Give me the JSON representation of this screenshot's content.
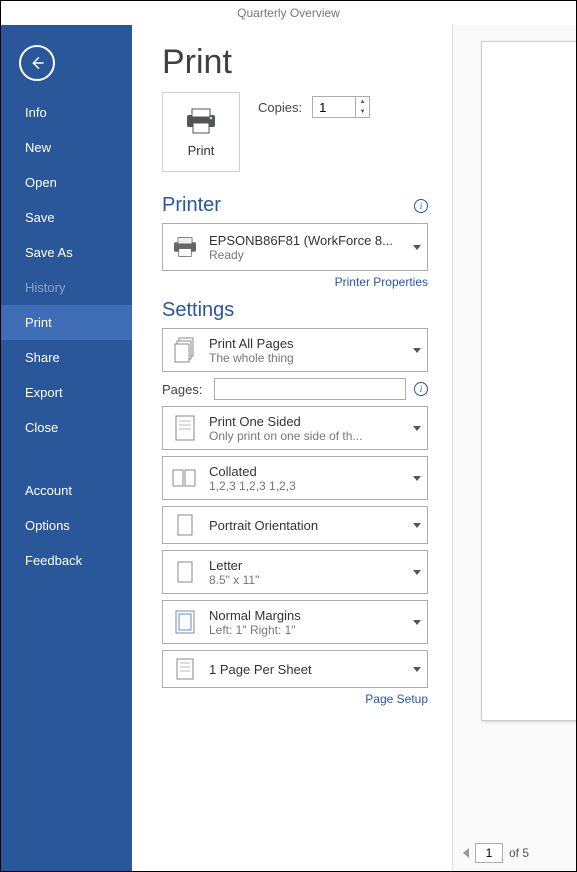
{
  "titlebar": "Quarterly Overview",
  "sidebar": {
    "items": [
      {
        "label": "Info"
      },
      {
        "label": "New"
      },
      {
        "label": "Open"
      },
      {
        "label": "Save"
      },
      {
        "label": "Save As"
      },
      {
        "label": "History"
      },
      {
        "label": "Print"
      },
      {
        "label": "Share"
      },
      {
        "label": "Export"
      },
      {
        "label": "Close"
      },
      {
        "label": "Account"
      },
      {
        "label": "Options"
      },
      {
        "label": "Feedback"
      }
    ]
  },
  "page": {
    "title": "Print",
    "print_button": "Print",
    "copies_label": "Copies:",
    "copies_value": "1"
  },
  "printer": {
    "heading": "Printer",
    "name": "EPSONB86F81 (WorkForce 8...",
    "status": "Ready",
    "properties_link": "Printer Properties"
  },
  "settings": {
    "heading": "Settings",
    "print_range": {
      "l1": "Print All Pages",
      "l2": "The whole thing"
    },
    "pages_label": "Pages:",
    "pages_value": "",
    "sides": {
      "l1": "Print One Sided",
      "l2": "Only print on one side of th..."
    },
    "collate": {
      "l1": "Collated",
      "l2": "1,2,3    1,2,3    1,2,3"
    },
    "orientation": {
      "l1": "Portrait Orientation"
    },
    "paper": {
      "l1": "Letter",
      "l2": "8.5\" x 11\""
    },
    "margins": {
      "l1": "Normal Margins",
      "l2": "Left:  1\"    Right:  1\""
    },
    "per_sheet": {
      "l1": "1 Page Per Sheet"
    },
    "page_setup_link": "Page Setup"
  },
  "preview": {
    "current_page": "1",
    "total_label": "of 5"
  }
}
